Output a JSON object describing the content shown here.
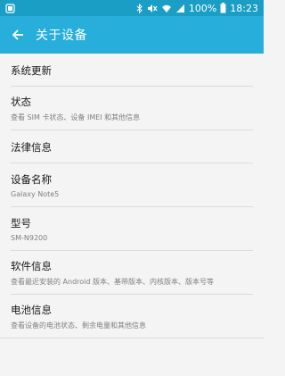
{
  "status_bar": {
    "battery_percent": "100%",
    "time": "18:23",
    "icons": [
      "notification-icon",
      "bluetooth-icon",
      "mute-icon",
      "wifi-icon",
      "signal-icon",
      "battery-icon"
    ]
  },
  "app_bar": {
    "back_icon": "arrow-left-icon",
    "title": "关于设备"
  },
  "items": [
    {
      "title": "系统更新"
    },
    {
      "title": "状态",
      "subtitle": "查看 SIM 卡状态、设备 IMEI 和其他信息"
    },
    {
      "title": "法律信息"
    },
    {
      "title": "设备名称",
      "subtitle": "Galaxy Note5"
    },
    {
      "title": "型号",
      "subtitle": "SM-N9200"
    },
    {
      "title": "软件信息",
      "subtitle": "查看最近安装的 Android 版本、基带版本、内核版本、版本号等"
    },
    {
      "title": "电池信息",
      "subtitle": "查看设备的电池状态、剩余电量和其他信息"
    }
  ],
  "colors": {
    "status_bar": "#1a9ec6",
    "app_bar": "#28aedb",
    "background": "#f4f4f4"
  }
}
